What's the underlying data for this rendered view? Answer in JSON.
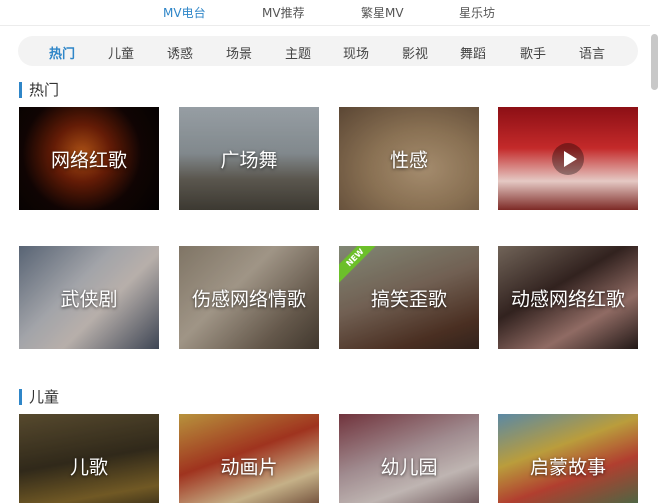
{
  "top_tabs": [
    {
      "label": "MV电台",
      "active": true
    },
    {
      "label": "MV推荐",
      "active": false
    },
    {
      "label": "繁星MV",
      "active": false
    },
    {
      "label": "星乐坊",
      "active": false
    }
  ],
  "categories": [
    {
      "label": "热门",
      "active": true
    },
    {
      "label": "儿童"
    },
    {
      "label": "诱惑"
    },
    {
      "label": "场景"
    },
    {
      "label": "主题"
    },
    {
      "label": "现场"
    },
    {
      "label": "影视"
    },
    {
      "label": "舞蹈"
    },
    {
      "label": "歌手"
    },
    {
      "label": "语言"
    }
  ],
  "sections": [
    {
      "title": "热门",
      "tiles": [
        {
          "label": "网络红歌"
        },
        {
          "label": "广场舞"
        },
        {
          "label": "性感"
        },
        {
          "label": "",
          "play_icon": true
        },
        {
          "label": "武侠剧"
        },
        {
          "label": "伤感网络情歌"
        },
        {
          "label": "搞笑歪歌",
          "badge": "NEW"
        },
        {
          "label": "动感网络红歌"
        }
      ]
    },
    {
      "title": "儿童",
      "tiles": [
        {
          "label": "儿歌"
        },
        {
          "label": "动画片"
        },
        {
          "label": "幼儿园"
        },
        {
          "label": "启蒙故事"
        }
      ]
    }
  ]
}
